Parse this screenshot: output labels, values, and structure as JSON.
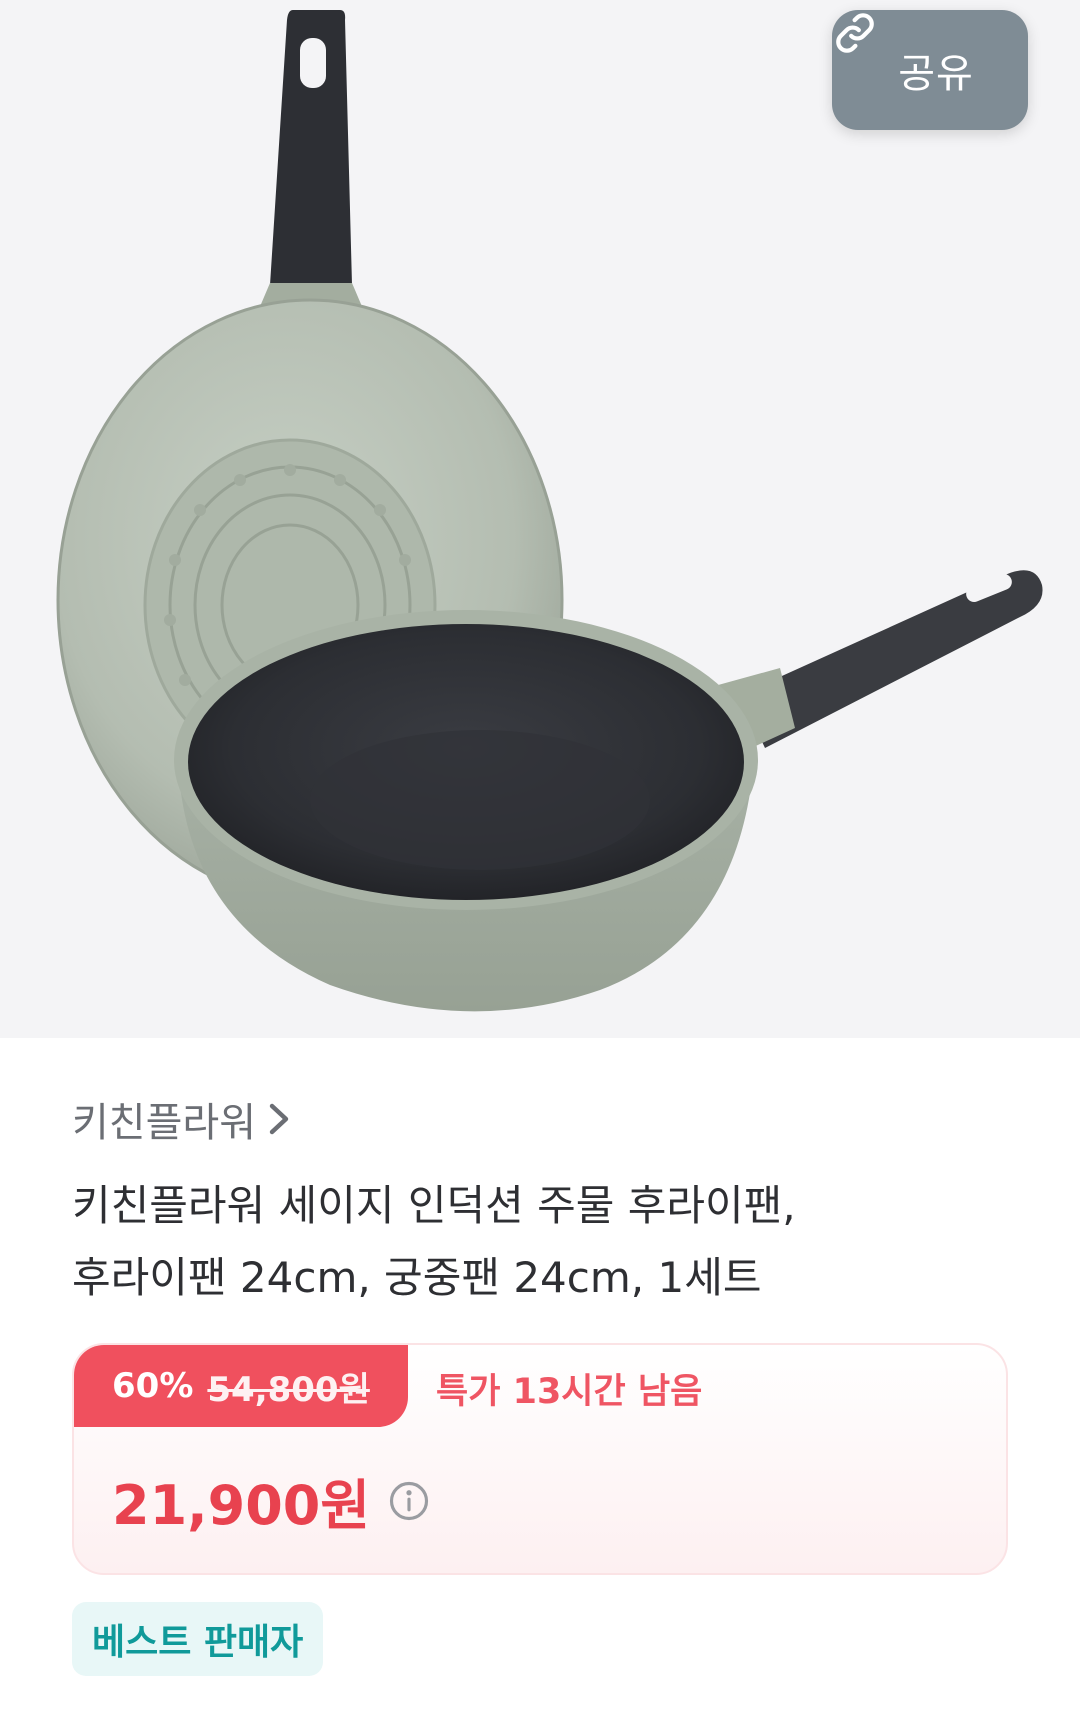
{
  "header": {
    "share_label": "공유",
    "share_icon": "link-icon"
  },
  "product": {
    "brand": "키친플라워",
    "title_line1": "키친플라워 세이지 인덕션 주물 후라이팬,",
    "title_line2": "후라이팬 24cm, 궁중팬 24cm, 1세트",
    "image_alt": "Sage green frying pan and wok set with black non-stick interior and dark handles"
  },
  "pricing": {
    "discount": "60%",
    "original_price": "54,800원",
    "deal_timer": "특가 13시간 남음",
    "sale_price": "21,900원"
  },
  "badges": {
    "seller": "베스트 판매자"
  },
  "colors": {
    "accent_red": "#f0505e",
    "sale_red": "#e8424f",
    "badge_teal": "#109a9a",
    "share_gray": "#7f8c95"
  }
}
